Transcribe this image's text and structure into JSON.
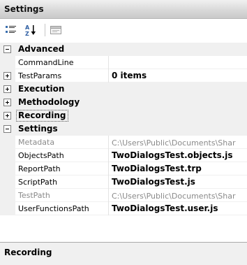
{
  "window": {
    "title": "Settings"
  },
  "toolbar": {
    "categorized_icon": "categorized-icon",
    "alphabetical_icon": "alphabetical-icon",
    "property_pages_icon": "property-pages-icon"
  },
  "grid": {
    "rows": [
      {
        "kind": "category",
        "label": "Advanced",
        "expander": "minus"
      },
      {
        "kind": "property",
        "name": "CommandLine",
        "value": ""
      },
      {
        "kind": "property",
        "name": "TestParams",
        "value": "0 items",
        "expander": "plus"
      },
      {
        "kind": "category",
        "label": "Execution",
        "expander": "plus"
      },
      {
        "kind": "category",
        "label": "Methodology",
        "expander": "plus"
      },
      {
        "kind": "category",
        "label": "Recording",
        "expander": "plus",
        "focused": true
      },
      {
        "kind": "category",
        "label": "Settings",
        "expander": "minus"
      },
      {
        "kind": "property",
        "name": "Metadata",
        "value": "C:\\Users\\Public\\Documents\\Shar",
        "dim": true
      },
      {
        "kind": "property",
        "name": "ObjectsPath",
        "value": "TwoDialogsTest.objects.js"
      },
      {
        "kind": "property",
        "name": "ReportPath",
        "value": "TwoDialogsTest.trp"
      },
      {
        "kind": "property",
        "name": "ScriptPath",
        "value": "TwoDialogsTest.js"
      },
      {
        "kind": "property",
        "name": "TestPath",
        "value": "C:\\Users\\Public\\Documents\\Shar",
        "dim": true
      },
      {
        "kind": "property",
        "name": "UserFunctionsPath",
        "value": "TwoDialogsTest.user.js"
      }
    ]
  },
  "description": {
    "title": "Recording"
  },
  "colors": {
    "category_band": "#f0f0f0",
    "dim_text": "#8a8a8a"
  }
}
